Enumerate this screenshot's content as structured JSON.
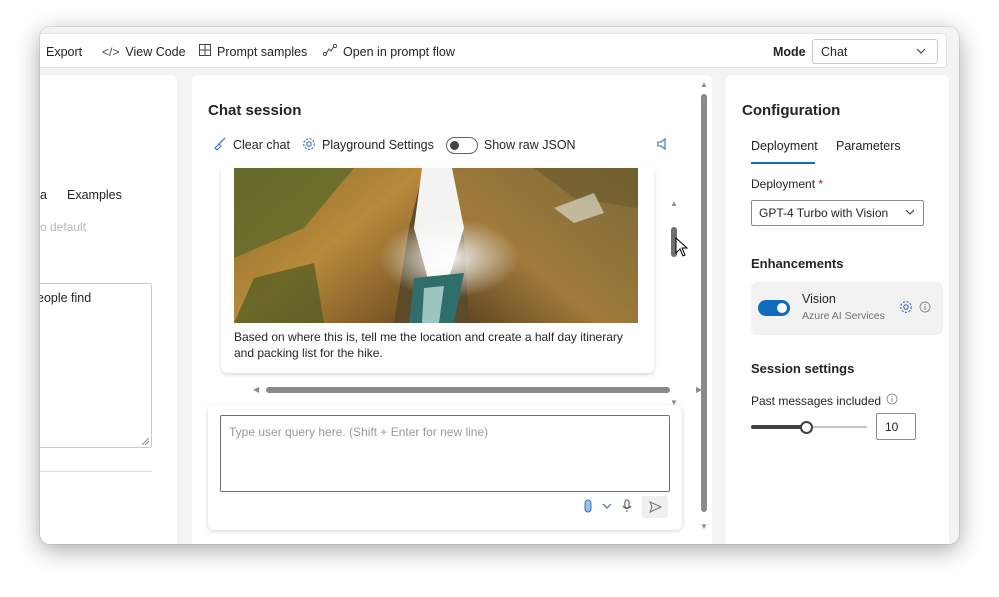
{
  "toolbar": {
    "export": "Export",
    "view_code": "View Code",
    "prompt_samples": "Prompt samples",
    "open_prompt_flow": "Open in prompt flow",
    "mode_label": "Mode",
    "mode_value": "Chat"
  },
  "left_panel": {
    "tab_partial": "a",
    "tab_examples": "Examples",
    "default_partial": "o default",
    "textarea_partial": "eople find"
  },
  "chat": {
    "title": "Chat session",
    "clear_chat": "Clear chat",
    "playground_settings": "Playground Settings",
    "show_raw_json": "Show raw JSON",
    "message_text": "Based on where this is, tell me the location and create a half day itinerary and packing list for the hike.",
    "input_placeholder": "Type user query here. (Shift + Enter for new line)"
  },
  "config": {
    "title": "Configuration",
    "tab_deployment": "Deployment",
    "tab_parameters": "Parameters",
    "deployment_label": "Deployment",
    "deployment_required": "*",
    "deployment_value": "GPT-4 Turbo with Vision",
    "enhancements_title": "Enhancements",
    "vision_name": "Vision",
    "vision_sub": "Azure AI Services",
    "vision_enabled": true,
    "session_title": "Session settings",
    "past_messages_label": "Past messages included",
    "past_messages_value": "10",
    "past_messages_slider_fraction": 0.47
  },
  "colors": {
    "accent": "#0f6cbd",
    "icon_blue": "#3a6fb5",
    "required": "#c50f1f"
  }
}
